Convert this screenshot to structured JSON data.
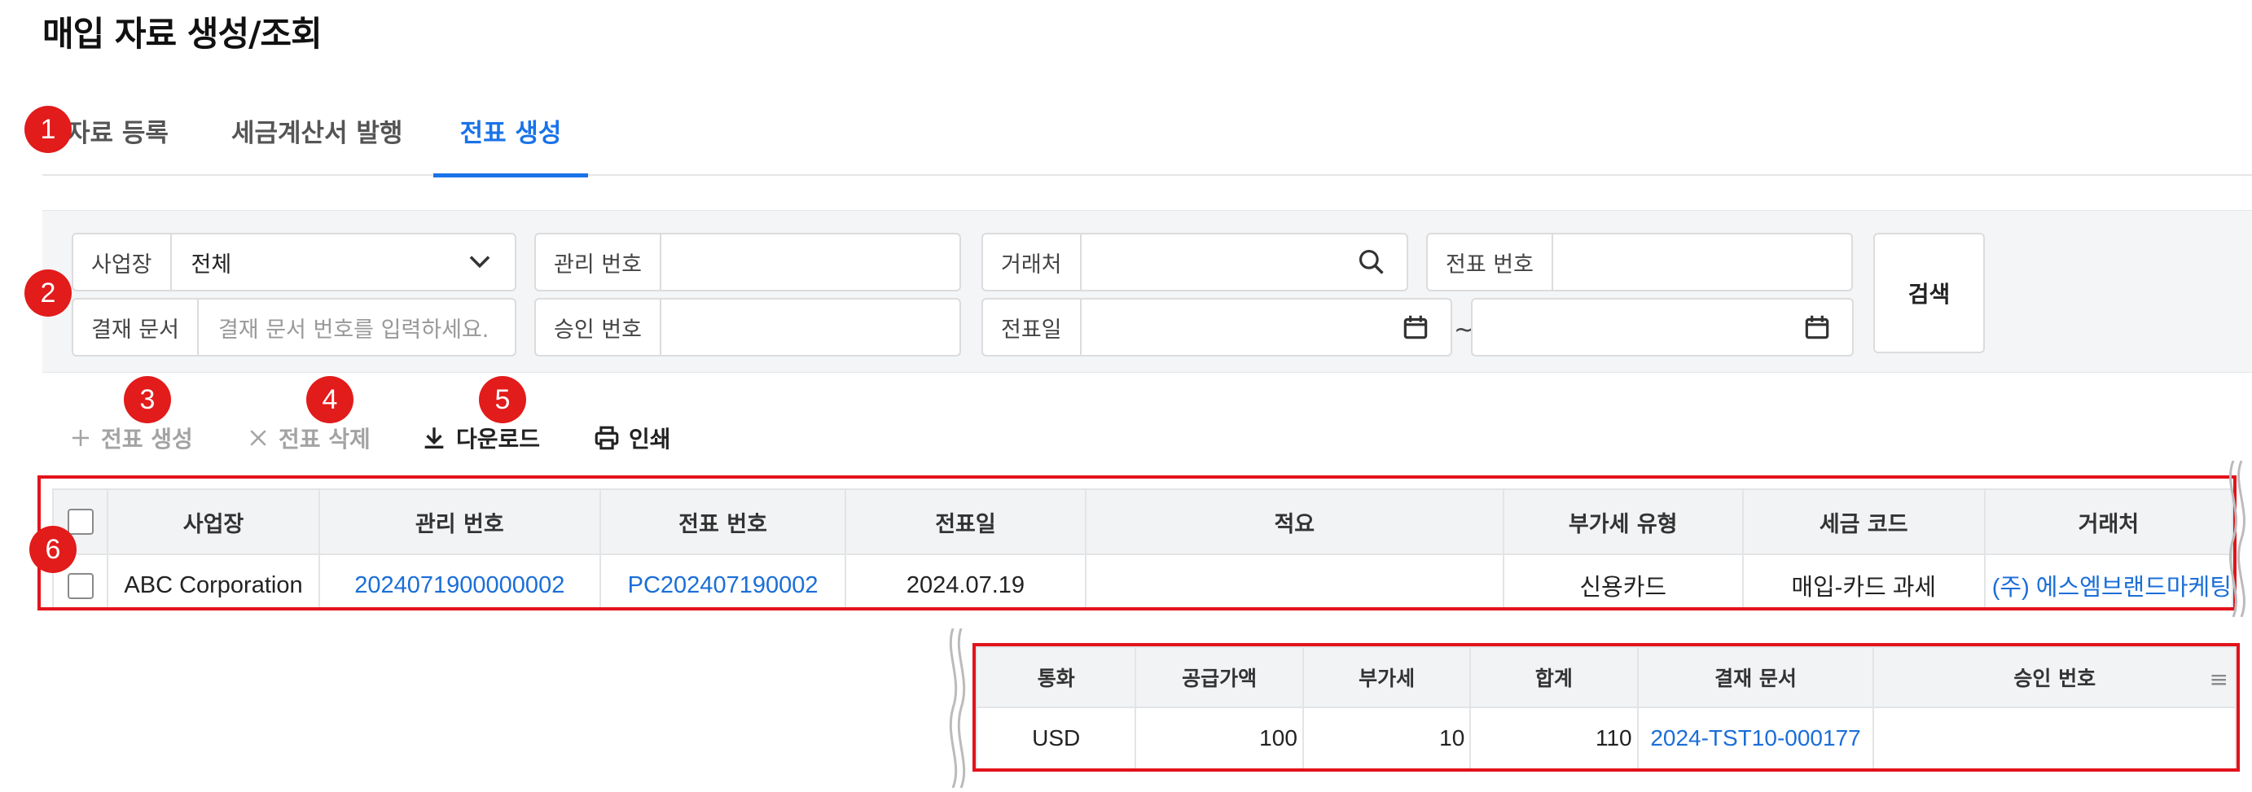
{
  "page": {
    "title": "매입 자료 생성/조회"
  },
  "tabs": [
    {
      "label": "자료 등록",
      "active": false
    },
    {
      "label": "세금계산서 발행",
      "active": false
    },
    {
      "label": "전표 생성",
      "active": true
    }
  ],
  "filters": {
    "business": {
      "label": "사업장",
      "value": "전체"
    },
    "management_no": {
      "label": "관리 번호",
      "value": ""
    },
    "vendor": {
      "label": "거래처",
      "value": ""
    },
    "slip_no": {
      "label": "전표 번호",
      "value": ""
    },
    "payment_doc": {
      "label": "결재 문서",
      "placeholder": "결재 문서 번호를 입력하세요."
    },
    "approval_no": {
      "label": "승인 번호",
      "value": ""
    },
    "slip_date": {
      "label": "전표일",
      "from": "",
      "to": "",
      "separator": "~"
    },
    "search_label": "검색"
  },
  "toolbar": {
    "create_label": "전표 생성",
    "delete_label": "전표 삭제",
    "download_label": "다운로드",
    "print_label": "인쇄"
  },
  "badges": [
    "1",
    "2",
    "3",
    "4",
    "5",
    "6"
  ],
  "grid_top": {
    "headers": [
      "사업장",
      "관리 번호",
      "전표 번호",
      "전표일",
      "적요",
      "부가세 유형",
      "세금 코드",
      "거래처"
    ],
    "rows": [
      [
        "ABC Corporation",
        "2024071900000002",
        "PC202407190002",
        "2024.07.19",
        "",
        "신용카드",
        "매입-카드 과세",
        "(주) 에스엠브랜드마케팅"
      ]
    ]
  },
  "grid_bottom": {
    "headers": [
      "통화",
      "공급가액",
      "부가세",
      "합계",
      "결재 문서",
      "승인 번호"
    ],
    "rows": [
      [
        "USD",
        "100",
        "10",
        "110",
        "2024-TST10-000177",
        ""
      ]
    ]
  },
  "colors": {
    "accent": "#1a73e8",
    "link": "#1a6ed8",
    "highlight": "#e2131b"
  }
}
